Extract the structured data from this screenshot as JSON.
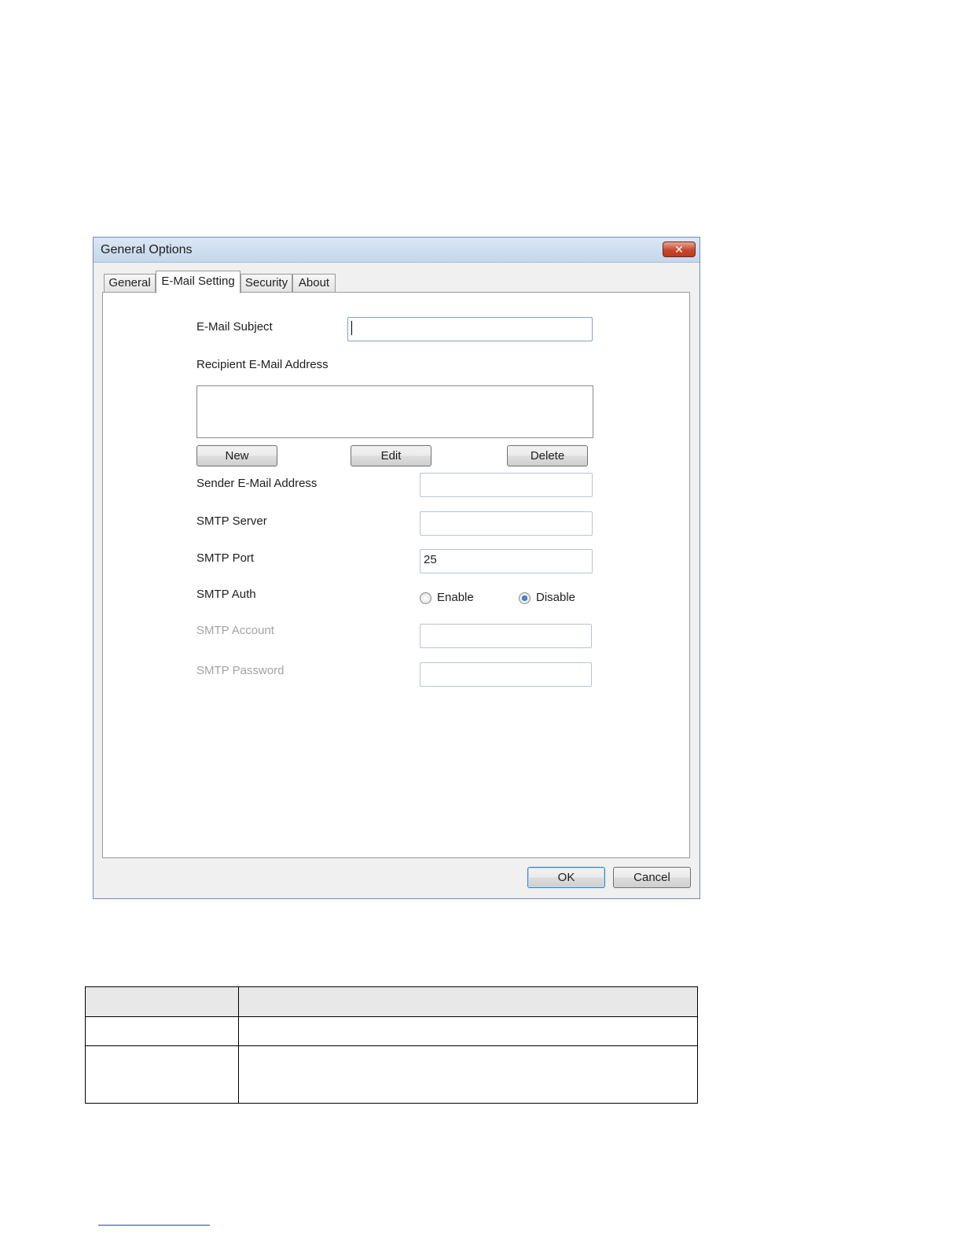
{
  "window": {
    "title": "General Options",
    "close_symbol": "✕"
  },
  "tabs": [
    {
      "label": "General",
      "active": false
    },
    {
      "label": "E-Mail Setting",
      "active": true
    },
    {
      "label": "Security",
      "active": false
    },
    {
      "label": "About",
      "active": false
    }
  ],
  "form": {
    "email_subject_label": "E-Mail Subject",
    "email_subject_value": "",
    "recipient_label": "Recipient E-Mail Address",
    "recipient_list": [],
    "new_button": "New",
    "edit_button": "Edit",
    "delete_button": "Delete",
    "sender_label": "Sender E-Mail Address",
    "sender_value": "",
    "smtp_server_label": "SMTP Server",
    "smtp_server_value": "",
    "smtp_port_label": "SMTP Port",
    "smtp_port_value": "25",
    "smtp_auth_label": "SMTP Auth",
    "auth_enable_label": "Enable",
    "auth_disable_label": "Disable",
    "auth_selected": "Disable",
    "smtp_account_label": "SMTP Account",
    "smtp_account_value": "",
    "smtp_password_label": "SMTP Password",
    "smtp_password_value": ""
  },
  "footer": {
    "ok_button": "OK",
    "cancel_button": "Cancel"
  },
  "table": {
    "headers": [
      "",
      ""
    ],
    "rows": [
      [
        "",
        ""
      ],
      [
        "",
        ""
      ]
    ]
  },
  "colors": {
    "titlebar": "#c5d6ea",
    "close_button": "#c8462e",
    "dialog_background": "#f0f0f0",
    "panel_background": "#ffffff",
    "table_header": "#e8e8e8",
    "footnote_rule": "#1f4e9c"
  }
}
